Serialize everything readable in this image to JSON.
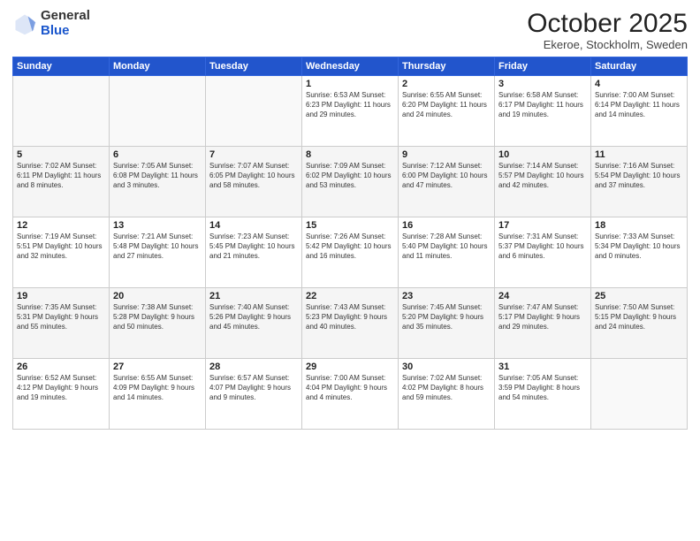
{
  "logo": {
    "general": "General",
    "blue": "Blue"
  },
  "header": {
    "month": "October 2025",
    "location": "Ekeroe, Stockholm, Sweden"
  },
  "days_of_week": [
    "Sunday",
    "Monday",
    "Tuesday",
    "Wednesday",
    "Thursday",
    "Friday",
    "Saturday"
  ],
  "weeks": [
    [
      {
        "day": "",
        "info": ""
      },
      {
        "day": "",
        "info": ""
      },
      {
        "day": "",
        "info": ""
      },
      {
        "day": "1",
        "info": "Sunrise: 6:53 AM\nSunset: 6:23 PM\nDaylight: 11 hours\nand 29 minutes."
      },
      {
        "day": "2",
        "info": "Sunrise: 6:55 AM\nSunset: 6:20 PM\nDaylight: 11 hours\nand 24 minutes."
      },
      {
        "day": "3",
        "info": "Sunrise: 6:58 AM\nSunset: 6:17 PM\nDaylight: 11 hours\nand 19 minutes."
      },
      {
        "day": "4",
        "info": "Sunrise: 7:00 AM\nSunset: 6:14 PM\nDaylight: 11 hours\nand 14 minutes."
      }
    ],
    [
      {
        "day": "5",
        "info": "Sunrise: 7:02 AM\nSunset: 6:11 PM\nDaylight: 11 hours\nand 8 minutes."
      },
      {
        "day": "6",
        "info": "Sunrise: 7:05 AM\nSunset: 6:08 PM\nDaylight: 11 hours\nand 3 minutes."
      },
      {
        "day": "7",
        "info": "Sunrise: 7:07 AM\nSunset: 6:05 PM\nDaylight: 10 hours\nand 58 minutes."
      },
      {
        "day": "8",
        "info": "Sunrise: 7:09 AM\nSunset: 6:02 PM\nDaylight: 10 hours\nand 53 minutes."
      },
      {
        "day": "9",
        "info": "Sunrise: 7:12 AM\nSunset: 6:00 PM\nDaylight: 10 hours\nand 47 minutes."
      },
      {
        "day": "10",
        "info": "Sunrise: 7:14 AM\nSunset: 5:57 PM\nDaylight: 10 hours\nand 42 minutes."
      },
      {
        "day": "11",
        "info": "Sunrise: 7:16 AM\nSunset: 5:54 PM\nDaylight: 10 hours\nand 37 minutes."
      }
    ],
    [
      {
        "day": "12",
        "info": "Sunrise: 7:19 AM\nSunset: 5:51 PM\nDaylight: 10 hours\nand 32 minutes."
      },
      {
        "day": "13",
        "info": "Sunrise: 7:21 AM\nSunset: 5:48 PM\nDaylight: 10 hours\nand 27 minutes."
      },
      {
        "day": "14",
        "info": "Sunrise: 7:23 AM\nSunset: 5:45 PM\nDaylight: 10 hours\nand 21 minutes."
      },
      {
        "day": "15",
        "info": "Sunrise: 7:26 AM\nSunset: 5:42 PM\nDaylight: 10 hours\nand 16 minutes."
      },
      {
        "day": "16",
        "info": "Sunrise: 7:28 AM\nSunset: 5:40 PM\nDaylight: 10 hours\nand 11 minutes."
      },
      {
        "day": "17",
        "info": "Sunrise: 7:31 AM\nSunset: 5:37 PM\nDaylight: 10 hours\nand 6 minutes."
      },
      {
        "day": "18",
        "info": "Sunrise: 7:33 AM\nSunset: 5:34 PM\nDaylight: 10 hours\nand 0 minutes."
      }
    ],
    [
      {
        "day": "19",
        "info": "Sunrise: 7:35 AM\nSunset: 5:31 PM\nDaylight: 9 hours\nand 55 minutes."
      },
      {
        "day": "20",
        "info": "Sunrise: 7:38 AM\nSunset: 5:28 PM\nDaylight: 9 hours\nand 50 minutes."
      },
      {
        "day": "21",
        "info": "Sunrise: 7:40 AM\nSunset: 5:26 PM\nDaylight: 9 hours\nand 45 minutes."
      },
      {
        "day": "22",
        "info": "Sunrise: 7:43 AM\nSunset: 5:23 PM\nDaylight: 9 hours\nand 40 minutes."
      },
      {
        "day": "23",
        "info": "Sunrise: 7:45 AM\nSunset: 5:20 PM\nDaylight: 9 hours\nand 35 minutes."
      },
      {
        "day": "24",
        "info": "Sunrise: 7:47 AM\nSunset: 5:17 PM\nDaylight: 9 hours\nand 29 minutes."
      },
      {
        "day": "25",
        "info": "Sunrise: 7:50 AM\nSunset: 5:15 PM\nDaylight: 9 hours\nand 24 minutes."
      }
    ],
    [
      {
        "day": "26",
        "info": "Sunrise: 6:52 AM\nSunset: 4:12 PM\nDaylight: 9 hours\nand 19 minutes."
      },
      {
        "day": "27",
        "info": "Sunrise: 6:55 AM\nSunset: 4:09 PM\nDaylight: 9 hours\nand 14 minutes."
      },
      {
        "day": "28",
        "info": "Sunrise: 6:57 AM\nSunset: 4:07 PM\nDaylight: 9 hours\nand 9 minutes."
      },
      {
        "day": "29",
        "info": "Sunrise: 7:00 AM\nSunset: 4:04 PM\nDaylight: 9 hours\nand 4 minutes."
      },
      {
        "day": "30",
        "info": "Sunrise: 7:02 AM\nSunset: 4:02 PM\nDaylight: 8 hours\nand 59 minutes."
      },
      {
        "day": "31",
        "info": "Sunrise: 7:05 AM\nSunset: 3:59 PM\nDaylight: 8 hours\nand 54 minutes."
      },
      {
        "day": "",
        "info": ""
      }
    ]
  ]
}
